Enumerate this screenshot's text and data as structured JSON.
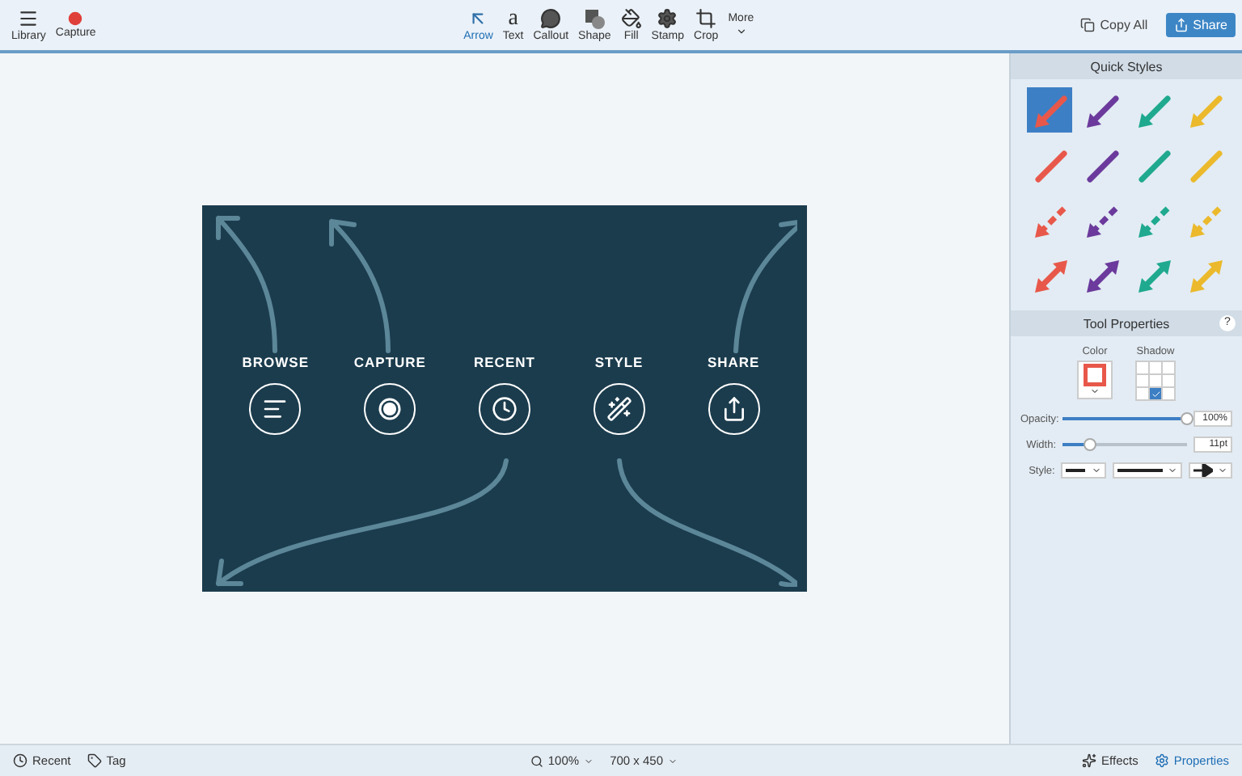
{
  "toolbar": {
    "left": [
      {
        "label": "Library"
      },
      {
        "label": "Capture"
      }
    ],
    "tools": [
      {
        "label": "Arrow",
        "selected": true
      },
      {
        "label": "Text",
        "glyph": "a",
        "selected": false
      },
      {
        "label": "Callout",
        "selected": false
      },
      {
        "label": "Shape",
        "selected": false
      },
      {
        "label": "Fill",
        "selected": false
      },
      {
        "label": "Stamp",
        "selected": false
      },
      {
        "label": "Crop",
        "selected": false
      }
    ],
    "more": "More",
    "copy_all": "Copy All",
    "share": "Share"
  },
  "canvas": {
    "items": [
      {
        "label": "BROWSE"
      },
      {
        "label": "CAPTURE"
      },
      {
        "label": "RECENT"
      },
      {
        "label": "STYLE"
      },
      {
        "label": "SHARE"
      }
    ]
  },
  "quick_styles": {
    "title": "Quick Styles",
    "items": [
      {
        "kind": "arrow",
        "color": "#e8584a",
        "selected": true
      },
      {
        "kind": "arrow",
        "color": "#6b3a9c",
        "selected": false
      },
      {
        "kind": "arrow",
        "color": "#1fa98f",
        "selected": false
      },
      {
        "kind": "arrow",
        "color": "#ebb92b",
        "selected": false
      },
      {
        "kind": "line",
        "color": "#e8584a",
        "selected": false
      },
      {
        "kind": "line",
        "color": "#6b3a9c",
        "selected": false
      },
      {
        "kind": "line",
        "color": "#1fa98f",
        "selected": false
      },
      {
        "kind": "line",
        "color": "#ebb92b",
        "selected": false
      },
      {
        "kind": "dashed",
        "color": "#e8584a",
        "selected": false
      },
      {
        "kind": "dashed",
        "color": "#6b3a9c",
        "selected": false
      },
      {
        "kind": "dashed",
        "color": "#1fa98f",
        "selected": false
      },
      {
        "kind": "dashed",
        "color": "#ebb92b",
        "selected": false
      },
      {
        "kind": "double",
        "color": "#e8584a",
        "selected": false
      },
      {
        "kind": "double",
        "color": "#6b3a9c",
        "selected": false
      },
      {
        "kind": "double",
        "color": "#1fa98f",
        "selected": false
      },
      {
        "kind": "double",
        "color": "#ebb92b",
        "selected": false
      }
    ]
  },
  "tool_properties": {
    "title": "Tool Properties",
    "help": "?",
    "color_label": "Color",
    "color": "#e8584a",
    "shadow_label": "Shadow",
    "shadow": [
      false,
      false,
      false,
      false,
      false,
      false,
      false,
      true,
      false
    ],
    "opacity": {
      "label": "Opacity:",
      "level": 1.0,
      "value": "100%"
    },
    "width": {
      "label": "Width:",
      "level": 0.22,
      "value": "11pt"
    },
    "style_label": "Style:"
  },
  "status_bar": {
    "left": [
      {
        "label": "Recent"
      },
      {
        "label": "Tag"
      }
    ],
    "zoom": "100%",
    "size": "700 x 450",
    "right": [
      {
        "label": "Effects",
        "selected": false
      },
      {
        "label": "Properties",
        "selected": true
      }
    ]
  }
}
